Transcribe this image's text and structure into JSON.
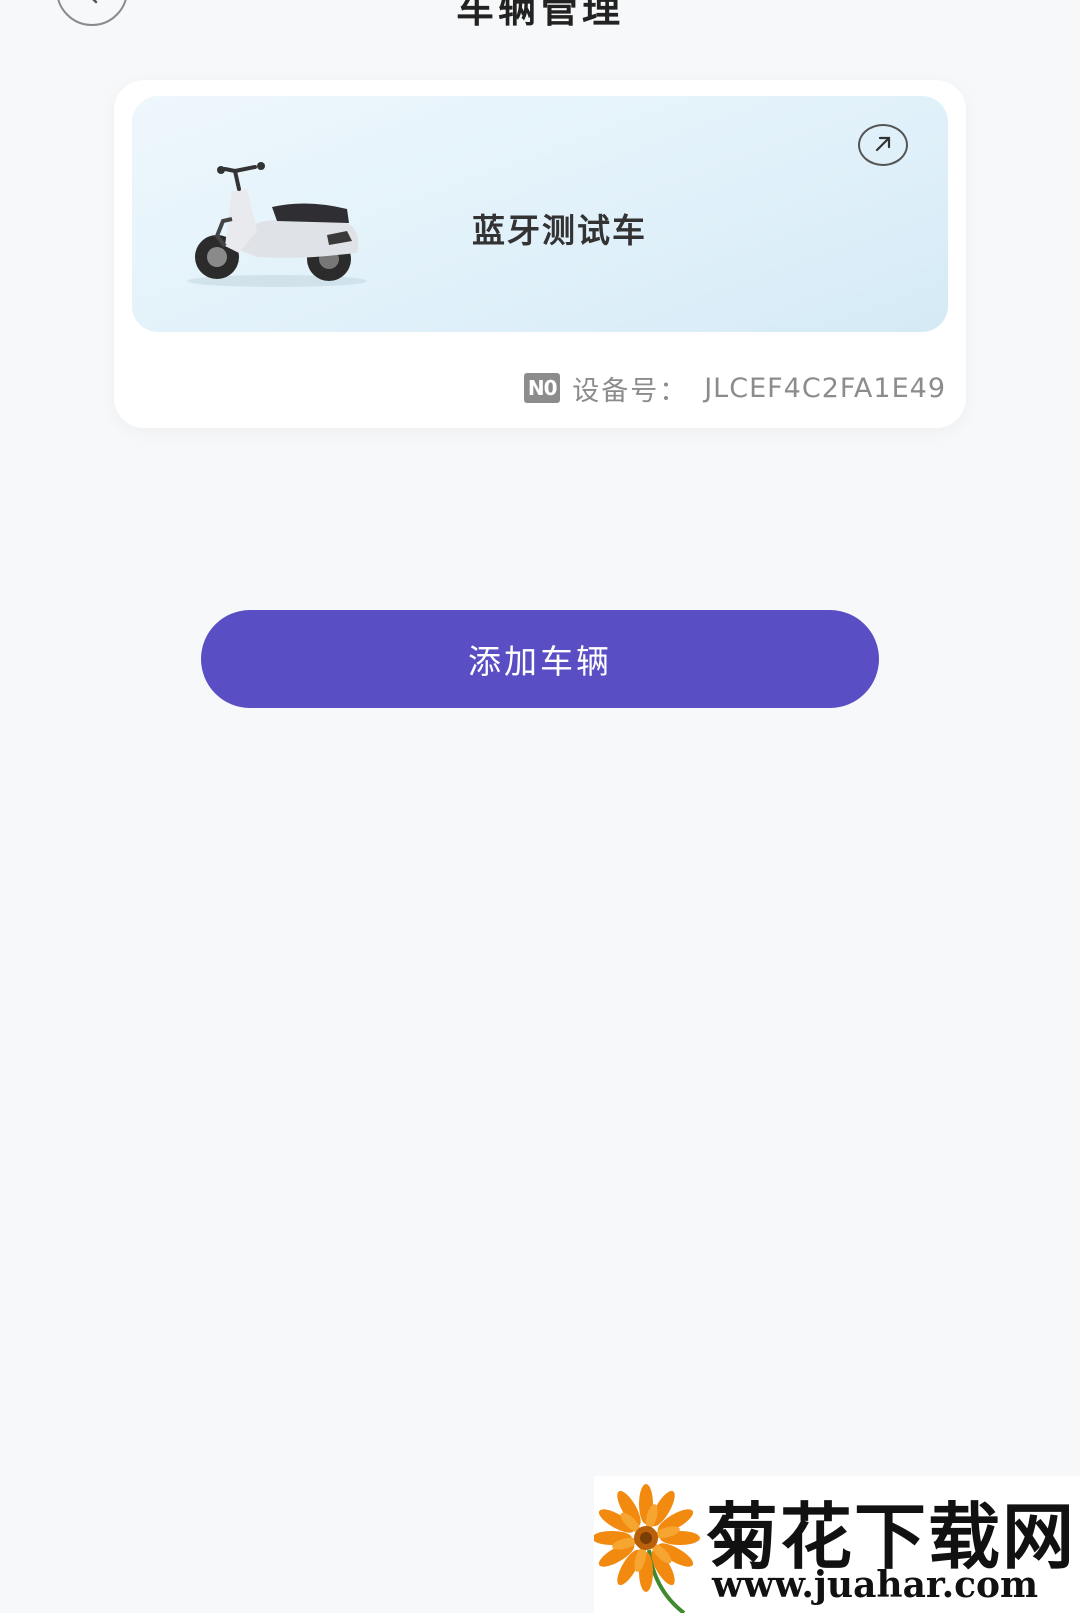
{
  "header": {
    "title": "车辆管理",
    "back_icon": "chevron-left-icon"
  },
  "vehicle": {
    "name": "蓝牙测试车",
    "image_icon": "scooter-image",
    "detail_icon": "arrow-up-right-icon",
    "device_icon_text": "N0",
    "device_label": "设备号：",
    "device_id": "JLCEF4C2FA1E49"
  },
  "actions": {
    "add_vehicle_label": "添加车辆"
  },
  "watermark": {
    "name": "菊花下载网",
    "url": "www.juahar.com"
  },
  "colors": {
    "accent": "#5a4ec4",
    "background": "#f7f8fa",
    "banner": "#e1f1fa"
  }
}
